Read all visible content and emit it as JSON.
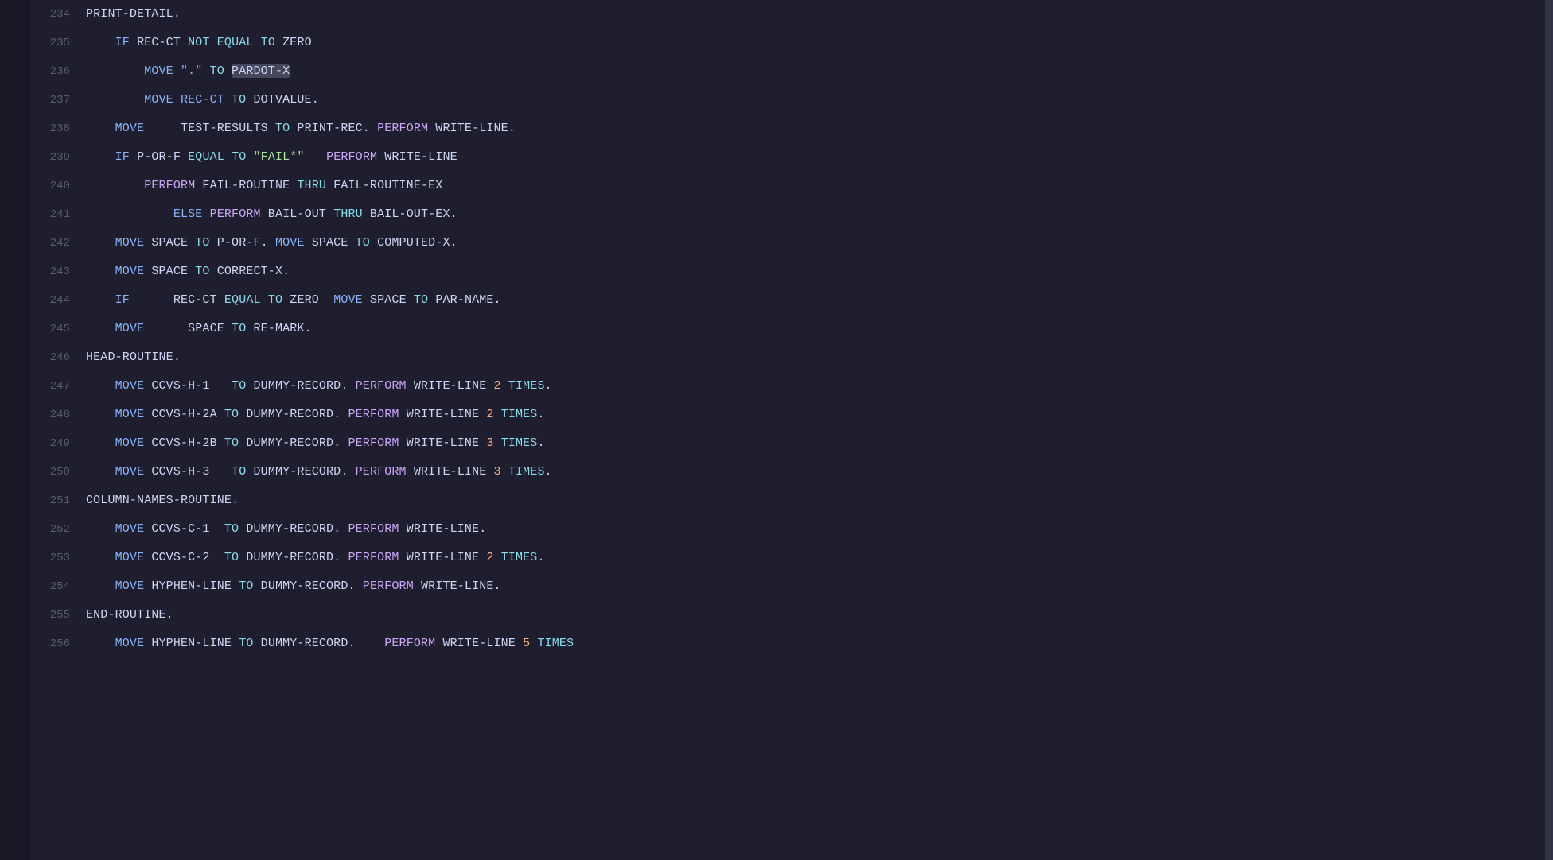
{
  "lines": [
    {
      "num": "235",
      "content": [
        {
          "t": "    ",
          "c": "var"
        },
        {
          "t": "IF",
          "c": "kw"
        },
        {
          "t": " REC-CT ",
          "c": "var"
        },
        {
          "t": "NOT",
          "c": "cond"
        },
        {
          "t": " ",
          "c": "var"
        },
        {
          "t": "EQUAL",
          "c": "cond"
        },
        {
          "t": " ",
          "c": "var"
        },
        {
          "t": "TO",
          "c": "to"
        },
        {
          "t": " ZERO",
          "c": "var"
        }
      ]
    },
    {
      "num": "236",
      "content": [
        {
          "t": "        MOVE \".\" ",
          "c": "kw"
        },
        {
          "t": "TO",
          "c": "to"
        },
        {
          "t": " ",
          "c": "var"
        },
        {
          "t": "PARDOT-X",
          "c": "highlight var"
        }
      ]
    },
    {
      "num": "237",
      "content": [
        {
          "t": "        MOVE REC-CT ",
          "c": "kw"
        },
        {
          "t": "TO",
          "c": "to"
        },
        {
          "t": " DOTVALUE.",
          "c": "var"
        }
      ]
    },
    {
      "num": "238",
      "content": [
        {
          "t": "    MOVE",
          "c": "kw"
        },
        {
          "t": "     TEST-RESULTS ",
          "c": "var"
        },
        {
          "t": "TO",
          "c": "to"
        },
        {
          "t": " PRINT-REC. ",
          "c": "var"
        },
        {
          "t": "PERFORM",
          "c": "kw2"
        },
        {
          "t": " WRITE-LINE.",
          "c": "var"
        }
      ]
    },
    {
      "num": "239",
      "content": [
        {
          "t": "    ",
          "c": "var"
        },
        {
          "t": "IF",
          "c": "kw"
        },
        {
          "t": " P-OR-F ",
          "c": "var"
        },
        {
          "t": "EQUAL",
          "c": "cond"
        },
        {
          "t": " ",
          "c": "var"
        },
        {
          "t": "TO",
          "c": "to"
        },
        {
          "t": " ",
          "c": "var"
        },
        {
          "t": "\"FAIL*\"",
          "c": "val"
        },
        {
          "t": "   ",
          "c": "var"
        },
        {
          "t": "PERFORM",
          "c": "kw2"
        },
        {
          "t": " WRITE-LINE",
          "c": "var"
        }
      ]
    },
    {
      "num": "240",
      "content": [
        {
          "t": "        ",
          "c": "var"
        },
        {
          "t": "PERFORM",
          "c": "kw2"
        },
        {
          "t": " FAIL-ROUTINE ",
          "c": "var"
        },
        {
          "t": "THRU",
          "c": "cond"
        },
        {
          "t": " FAIL-ROUTINE-EX",
          "c": "var"
        }
      ]
    },
    {
      "num": "241",
      "content": [
        {
          "t": "            ",
          "c": "var"
        },
        {
          "t": "ELSE",
          "c": "kw"
        },
        {
          "t": " ",
          "c": "var"
        },
        {
          "t": "PERFORM",
          "c": "kw2"
        },
        {
          "t": " BAIL-OUT ",
          "c": "var"
        },
        {
          "t": "THRU",
          "c": "cond"
        },
        {
          "t": " BAIL-OUT-EX.",
          "c": "var"
        }
      ]
    },
    {
      "num": "242",
      "content": [
        {
          "t": "    ",
          "c": "var"
        },
        {
          "t": "MOVE",
          "c": "kw"
        },
        {
          "t": " SPACE ",
          "c": "var"
        },
        {
          "t": "TO",
          "c": "to"
        },
        {
          "t": " P-OR-F. ",
          "c": "var"
        },
        {
          "t": "MOVE",
          "c": "kw"
        },
        {
          "t": " SPACE ",
          "c": "var"
        },
        {
          "t": "TO",
          "c": "to"
        },
        {
          "t": " COMPUTED-X.",
          "c": "var"
        }
      ]
    },
    {
      "num": "243",
      "content": [
        {
          "t": "    ",
          "c": "var"
        },
        {
          "t": "MOVE",
          "c": "kw"
        },
        {
          "t": " SPACE ",
          "c": "var"
        },
        {
          "t": "TO",
          "c": "to"
        },
        {
          "t": " CORRECT-X.",
          "c": "var"
        }
      ]
    },
    {
      "num": "244",
      "content": [
        {
          "t": "    ",
          "c": "var"
        },
        {
          "t": "IF",
          "c": "kw"
        },
        {
          "t": "      REC-CT ",
          "c": "var"
        },
        {
          "t": "EQUAL",
          "c": "cond"
        },
        {
          "t": " ",
          "c": "var"
        },
        {
          "t": "TO",
          "c": "to"
        },
        {
          "t": " ZERO  ",
          "c": "var"
        },
        {
          "t": "MOVE",
          "c": "kw"
        },
        {
          "t": " SPACE ",
          "c": "var"
        },
        {
          "t": "TO",
          "c": "to"
        },
        {
          "t": " PAR-NAME.",
          "c": "var"
        }
      ]
    },
    {
      "num": "245",
      "content": [
        {
          "t": "    ",
          "c": "var"
        },
        {
          "t": "MOVE",
          "c": "kw"
        },
        {
          "t": "      SPACE ",
          "c": "var"
        },
        {
          "t": "TO",
          "c": "to"
        },
        {
          "t": " RE-MARK.",
          "c": "var"
        }
      ]
    },
    {
      "num": "246",
      "content": [
        {
          "t": "HEAD-ROUTINE.",
          "c": "label"
        }
      ]
    },
    {
      "num": "247",
      "content": [
        {
          "t": "    ",
          "c": "var"
        },
        {
          "t": "MOVE",
          "c": "kw"
        },
        {
          "t": " CCVS-H-1   ",
          "c": "var"
        },
        {
          "t": "TO",
          "c": "to"
        },
        {
          "t": " DUMMY-RECORD. ",
          "c": "var"
        },
        {
          "t": "PERFORM",
          "c": "kw2"
        },
        {
          "t": " WRITE-LINE ",
          "c": "var"
        },
        {
          "t": "2",
          "c": "num"
        },
        {
          "t": " ",
          "c": "var"
        },
        {
          "t": "TIMES",
          "c": "times"
        },
        {
          "t": ".",
          "c": "var"
        }
      ]
    },
    {
      "num": "248",
      "content": [
        {
          "t": "    ",
          "c": "var"
        },
        {
          "t": "MOVE",
          "c": "kw"
        },
        {
          "t": " CCVS-H-2A ",
          "c": "var"
        },
        {
          "t": "TO",
          "c": "to"
        },
        {
          "t": " DUMMY-RECORD. ",
          "c": "var"
        },
        {
          "t": "PERFORM",
          "c": "kw2"
        },
        {
          "t": " WRITE-LINE ",
          "c": "var"
        },
        {
          "t": "2",
          "c": "num"
        },
        {
          "t": " ",
          "c": "var"
        },
        {
          "t": "TIMES",
          "c": "times"
        },
        {
          "t": ".",
          "c": "var"
        }
      ]
    },
    {
      "num": "249",
      "content": [
        {
          "t": "    ",
          "c": "var"
        },
        {
          "t": "MOVE",
          "c": "kw"
        },
        {
          "t": " CCVS-H-2B ",
          "c": "var"
        },
        {
          "t": "TO",
          "c": "to"
        },
        {
          "t": " DUMMY-RECORD. ",
          "c": "var"
        },
        {
          "t": "PERFORM",
          "c": "kw2"
        },
        {
          "t": " WRITE-LINE ",
          "c": "var"
        },
        {
          "t": "3",
          "c": "num"
        },
        {
          "t": " ",
          "c": "var"
        },
        {
          "t": "TIMES",
          "c": "times"
        },
        {
          "t": ".",
          "c": "var"
        }
      ]
    },
    {
      "num": "250",
      "content": [
        {
          "t": "    ",
          "c": "var"
        },
        {
          "t": "MOVE",
          "c": "kw"
        },
        {
          "t": " CCVS-H-3   ",
          "c": "var"
        },
        {
          "t": "TO",
          "c": "to"
        },
        {
          "t": " DUMMY-RECORD. ",
          "c": "var"
        },
        {
          "t": "PERFORM",
          "c": "kw2"
        },
        {
          "t": " WRITE-LINE ",
          "c": "var"
        },
        {
          "t": "3",
          "c": "num"
        },
        {
          "t": " ",
          "c": "var"
        },
        {
          "t": "TIMES",
          "c": "times"
        },
        {
          "t": ".",
          "c": "var"
        }
      ]
    },
    {
      "num": "251",
      "content": [
        {
          "t": "COLUMN-NAMES-ROUTINE.",
          "c": "label"
        }
      ]
    },
    {
      "num": "252",
      "content": [
        {
          "t": "    ",
          "c": "var"
        },
        {
          "t": "MOVE",
          "c": "kw"
        },
        {
          "t": " CCVS-C-1  ",
          "c": "var"
        },
        {
          "t": "TO",
          "c": "to"
        },
        {
          "t": " DUMMY-RECORD. ",
          "c": "var"
        },
        {
          "t": "PERFORM",
          "c": "kw2"
        },
        {
          "t": " WRITE-LINE.",
          "c": "var"
        }
      ]
    },
    {
      "num": "253",
      "content": [
        {
          "t": "    ",
          "c": "var"
        },
        {
          "t": "MOVE",
          "c": "kw"
        },
        {
          "t": " CCVS-C-2  ",
          "c": "var"
        },
        {
          "t": "TO",
          "c": "to"
        },
        {
          "t": " DUMMY-RECORD. ",
          "c": "var"
        },
        {
          "t": "PERFORM",
          "c": "kw2"
        },
        {
          "t": " WRITE-LINE ",
          "c": "var"
        },
        {
          "t": "2",
          "c": "num"
        },
        {
          "t": " ",
          "c": "var"
        },
        {
          "t": "TIMES",
          "c": "times"
        },
        {
          "t": ".",
          "c": "var"
        }
      ]
    },
    {
      "num": "254",
      "content": [
        {
          "t": "    ",
          "c": "var"
        },
        {
          "t": "MOVE",
          "c": "kw"
        },
        {
          "t": " HYPHEN-LINE ",
          "c": "var"
        },
        {
          "t": "TO",
          "c": "to"
        },
        {
          "t": " DUMMY-RECORD. ",
          "c": "var"
        },
        {
          "t": "PERFORM",
          "c": "kw2"
        },
        {
          "t": " WRITE-LINE.",
          "c": "var"
        }
      ]
    },
    {
      "num": "255",
      "content": [
        {
          "t": "END-ROUTINE.",
          "c": "label"
        }
      ]
    },
    {
      "num": "256",
      "content": [
        {
          "t": "    ",
          "c": "var"
        },
        {
          "t": "MOVE",
          "c": "kw"
        },
        {
          "t": " HYPHEN-LINE ",
          "c": "var"
        },
        {
          "t": "TO",
          "c": "to"
        },
        {
          "t": " DUMMY-RECORD.    ",
          "c": "var"
        },
        {
          "t": "PERFORM",
          "c": "kw2"
        },
        {
          "t": " WRITE-LINE ",
          "c": "var"
        },
        {
          "t": "5",
          "c": "num"
        },
        {
          "t": " ",
          "c": "var"
        },
        {
          "t": "TIMES",
          "c": "times"
        }
      ]
    }
  ],
  "topLineNum": "234",
  "topLineContent": "PRINT-DETAIL."
}
